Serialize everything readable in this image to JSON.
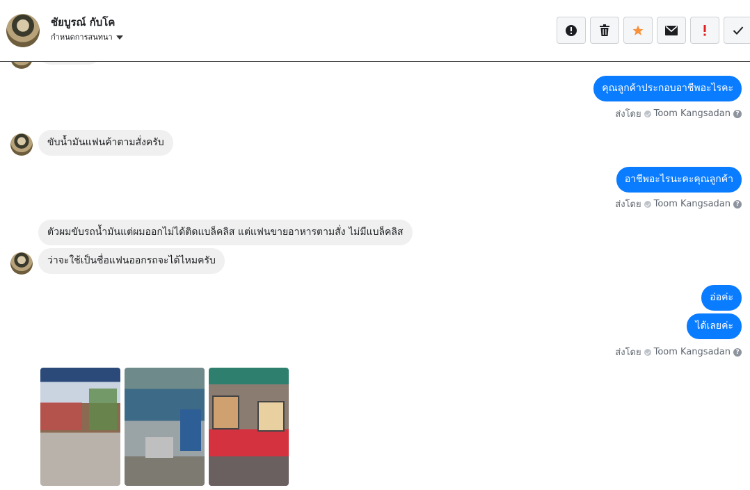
{
  "header": {
    "contact_name": "ชัยบูรณ์ กับโค",
    "subtitle": "กำหนดการสนทนา",
    "toolbar": [
      {
        "icon": "alert-circle-icon",
        "color": "#1c1e21"
      },
      {
        "icon": "trash-icon",
        "color": "#1c1e21"
      },
      {
        "icon": "star-icon",
        "color": "#f7923b"
      },
      {
        "icon": "envelope-icon",
        "color": "#1c1e21"
      },
      {
        "icon": "exclamation-icon",
        "color": "#e02020"
      },
      {
        "icon": "check-icon",
        "color": "#1c1e21"
      }
    ]
  },
  "colors": {
    "outgoing_bubble": "#0a7cff",
    "incoming_bubble": "#f0f0f0",
    "meta_text": "#606770"
  },
  "messages": [
    {
      "dir": "out",
      "text": "คุณลูกค้าประกอบอาชีพอะไรคะ"
    },
    {
      "dir": "meta",
      "prefix": "ส่งโดย",
      "sender": "Toom Kangsadan"
    },
    {
      "dir": "in",
      "text": "ขับน้ำมันแฟนค้าตามสั่งครับ"
    },
    {
      "dir": "out",
      "text": "อาชีพอะไรนะคะคุณลูกค้า"
    },
    {
      "dir": "meta",
      "prefix": "ส่งโดย",
      "sender": "Toom Kangsadan"
    },
    {
      "dir": "in",
      "text": "ตัวผมขับรถน้ำมันแต่ผมออกไม่ได้ติดแบล็คลิส แต่แฟนขายอาหารตามสั่ง ไม่มีแบล็คลิส"
    },
    {
      "dir": "in",
      "text": "ว่าจะใช้เป็นชื่อแฟนออกรถจะได้ไหมครับ"
    },
    {
      "dir": "out",
      "text": "อ่อค่ะ"
    },
    {
      "dir": "out",
      "text": "ได้เลยค่ะ"
    },
    {
      "dir": "meta",
      "prefix": "ส่งโดย",
      "sender": "Toom Kangsadan"
    }
  ],
  "attachments": {
    "count": 3
  }
}
